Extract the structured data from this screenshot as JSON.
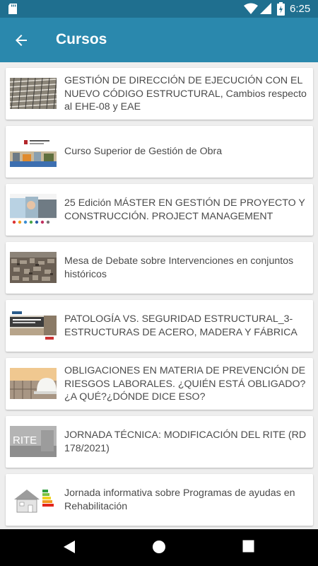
{
  "status_bar": {
    "time": "6:25"
  },
  "app_bar": {
    "title": "Cursos"
  },
  "courses": [
    {
      "title": "GESTIÓN DE DIRECCIÓN DE EJECUCIÓN CON EL NUEVO CÓDIGO ESTRUCTURAL, Cambios respecto al EHE-08 y EAE"
    },
    {
      "title": "Curso Superior de Gestión de Obra"
    },
    {
      "title": "25 Edición MÁSTER EN GESTIÓN DE PROYECTO Y CONSTRUCCIÓN. PROJECT MANAGEMENT"
    },
    {
      "title": "Mesa de Debate sobre Intervenciones en conjuntos históricos"
    },
    {
      "title": "PATOLOGÍA VS. SEGURIDAD ESTRUCTURAL_3-ESTRUCTURAS DE ACERO, MADERA Y FÁBRICA"
    },
    {
      "title": "OBLIGACIONES EN MATERIA DE PREVENCIÓN DE RIESGOS LABORALES. ¿QUIÉN ESTÁ OBLIGADO? ¿A QUÉ?¿DÓNDE DICE ESO?"
    },
    {
      "title": "JORNADA TÉCNICA: MODIFICACIÓN DEL RITE (RD 178/2021)",
      "thumb_text": "RITE"
    },
    {
      "title": "Jornada informativa sobre Programas de ayudas en Rehabilitación"
    }
  ],
  "colors": {
    "status_bar": "#1f6f8f",
    "app_bar": "#2a88ad",
    "background": "#eeeeee"
  }
}
